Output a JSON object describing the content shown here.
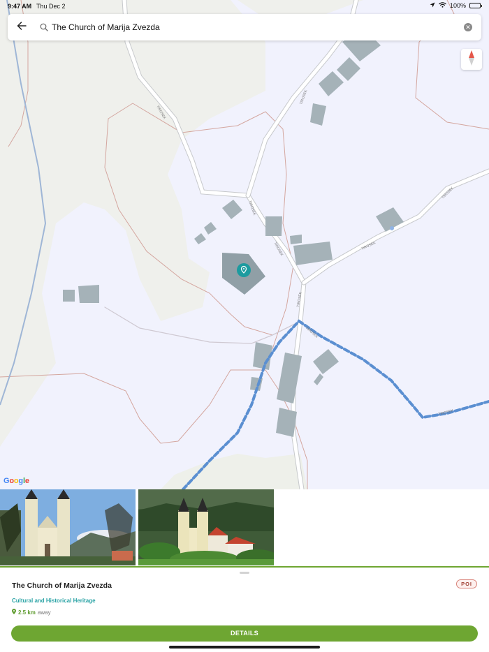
{
  "status_bar": {
    "time": "9:47 AM",
    "date": "Thu Dec 2",
    "battery": "100%"
  },
  "search": {
    "query": "The Church of Marija Zvezda"
  },
  "map": {
    "attribution": "Google",
    "road_labels": [
      "TIROSEK",
      "TIROSEK",
      "TIROSEK",
      "TIROSEK",
      "TIROSEK",
      "TIROSEK",
      "TIROSEK",
      "TIROSEK",
      "TIROSEK"
    ],
    "colors": {
      "land": "#eff0ec",
      "built_area": "#f1f2fd",
      "building": "#a5b2b8",
      "route": "#5b8fd1",
      "poi_marker": "#1c9b9f"
    }
  },
  "photos": [
    {
      "alt": "church-front-photo"
    },
    {
      "alt": "church-valley-photo"
    }
  ],
  "poi": {
    "title": "The Church of Marija Zvezda",
    "badge": "POI",
    "category": "Cultural and Historical Heritage",
    "distance": "2.5 km",
    "distance_suffix": "away",
    "details_label": "DETAILS"
  },
  "colors": {
    "accent_green": "#6ea632",
    "category_teal": "#2aa3a5"
  }
}
